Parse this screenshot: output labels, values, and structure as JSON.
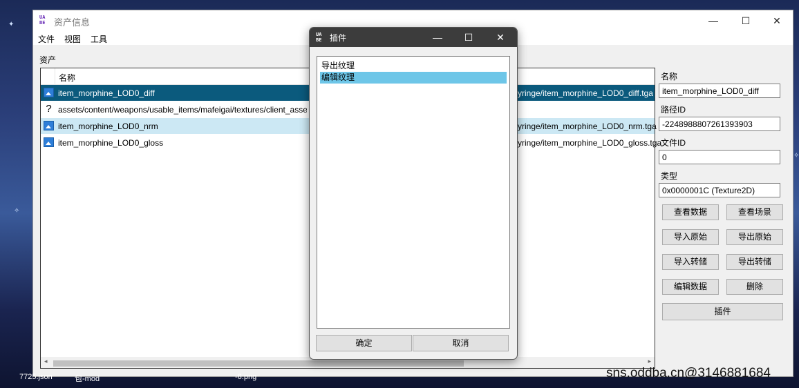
{
  "main_window": {
    "title": "资产信息",
    "controls": {
      "minimize": "—",
      "maximize": "☐",
      "close": "✕"
    },
    "menu": [
      "文件",
      "视图",
      "工具"
    ],
    "assets_label": "资产",
    "list": {
      "column_name": "名称",
      "rows": [
        {
          "icon": "image-icon",
          "name": "item_morphine_LOD0_diff",
          "path": "yringe/item_morphine_LOD0_diff.tga",
          "state": "selected"
        },
        {
          "icon": "unknown-icon",
          "name": "assets/content/weapons/usable_items/mafeigai/textures/client_assets",
          "path": "",
          "state": "normal"
        },
        {
          "icon": "image-icon",
          "name": "item_morphine_LOD0_nrm",
          "path": "yringe/item_morphine_LOD0_nrm.tga",
          "state": "highlight"
        },
        {
          "icon": "image-icon",
          "name": "item_morphine_LOD0_gloss",
          "path": "yringe/item_morphine_LOD0_gloss.tga",
          "state": "normal"
        }
      ],
      "scroll_left": "◂",
      "scroll_right": "▸"
    },
    "details": {
      "name_label": "名称",
      "name_value": "item_morphine_LOD0_diff",
      "pathid_label": "路径ID",
      "pathid_value": "-2248988807261393903",
      "fileid_label": "文件ID",
      "fileid_value": "0",
      "type_label": "类型",
      "type_value": "0x0000001C (Texture2D)"
    },
    "buttons": {
      "view_data": "查看数据",
      "view_scene": "查看场景",
      "import_raw": "导入原始",
      "export_raw": "导出原始",
      "import_dump": "导入转储",
      "export_dump": "导出转储",
      "edit_data": "编辑数据",
      "remove": "删除",
      "plugins": "插件"
    }
  },
  "dialog": {
    "title": "插件",
    "controls": {
      "minimize": "—",
      "maximize": "☐",
      "close": "✕"
    },
    "items": [
      "导出纹理",
      "编辑纹理"
    ],
    "selected_index": 1,
    "ok": "确定",
    "cancel": "取消"
  },
  "desktop": {
    "files": [
      "7725.json",
      "包-mod",
      "-6.png"
    ],
    "watermark": "sns.oddba.cn@3146881684"
  }
}
